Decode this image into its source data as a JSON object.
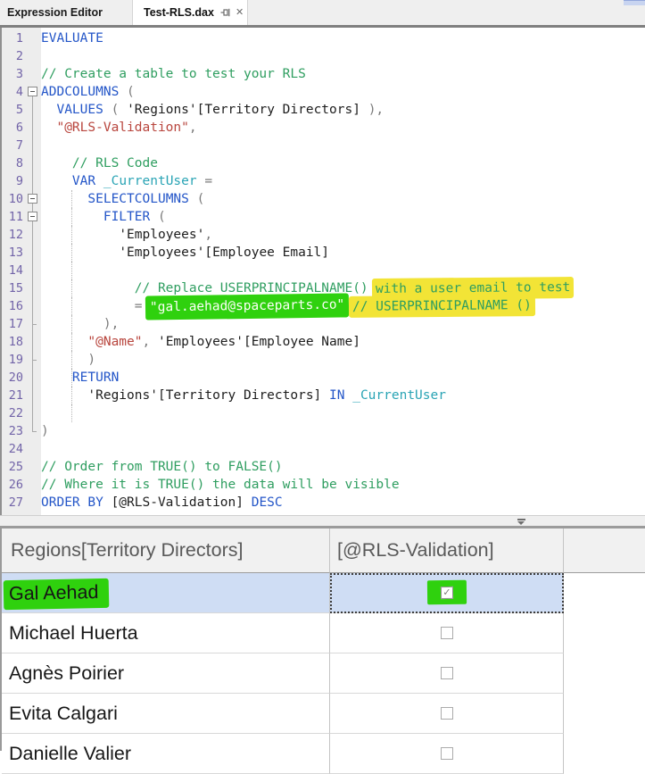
{
  "tabs": {
    "pane_title": "Expression Editor",
    "active_tab": "Test-RLS.dax",
    "pin_icon": "pin",
    "close_glyph": "✕"
  },
  "editor": {
    "lines": [
      {
        "f": "",
        "s": [
          {
            "t": "EVALUATE",
            "c": "k"
          }
        ]
      },
      {
        "f": "",
        "s": []
      },
      {
        "f": "",
        "s": [
          {
            "t": "// Create a table to test your RLS",
            "c": "c"
          }
        ]
      },
      {
        "f": "b0",
        "s": [
          {
            "t": "ADDCOLUMNS ",
            "c": "k"
          },
          {
            "t": "(",
            "c": "p"
          }
        ]
      },
      {
        "f": "l",
        "s": [
          {
            "t": "  ",
            "c": "t"
          },
          {
            "t": "VALUES",
            "c": "k"
          },
          {
            "t": " ( ",
            "c": "p"
          },
          {
            "t": "'Regions'[Territory Directors]",
            "c": "t"
          },
          {
            "t": " ),",
            "c": "p"
          }
        ]
      },
      {
        "f": "l",
        "s": [
          {
            "t": "  ",
            "c": "t"
          },
          {
            "t": "\"@RLS-Validation\"",
            "c": "s"
          },
          {
            "t": ",",
            "c": "p"
          }
        ]
      },
      {
        "f": "l",
        "s": []
      },
      {
        "f": "l",
        "s": [
          {
            "t": "    ",
            "c": "t"
          },
          {
            "t": "// RLS Code",
            "c": "c"
          }
        ]
      },
      {
        "f": "l",
        "s": [
          {
            "t": "    ",
            "c": "t"
          },
          {
            "t": "VAR",
            "c": "k"
          },
          {
            "t": " ",
            "c": "t"
          },
          {
            "t": "_CurrentUser",
            "c": "v"
          },
          {
            "t": " =",
            "c": "p"
          }
        ]
      },
      {
        "f": "b",
        "s": [
          {
            "t": "      ",
            "c": "t"
          },
          {
            "t": "SELECTCOLUMNS",
            "c": "k"
          },
          {
            "t": " (",
            "c": "p"
          }
        ]
      },
      {
        "f": "b",
        "s": [
          {
            "t": "        ",
            "c": "t"
          },
          {
            "t": "FILTER",
            "c": "k"
          },
          {
            "t": " (",
            "c": "p"
          }
        ]
      },
      {
        "f": "l",
        "s": [
          {
            "t": "          ",
            "c": "t"
          },
          {
            "t": "'Employees'",
            "c": "t"
          },
          {
            "t": ",",
            "c": "p"
          }
        ]
      },
      {
        "f": "l",
        "s": [
          {
            "t": "          ",
            "c": "t"
          },
          {
            "t": "'Employees'[Employee Email]",
            "c": "t"
          }
        ]
      },
      {
        "f": "l",
        "s": []
      },
      {
        "f": "l",
        "s": [
          {
            "t": "            ",
            "c": "t"
          },
          {
            "t": "// Replace USERPRINCIPALNAME() ",
            "c": "c"
          },
          {
            "t": "with a user email to test",
            "c": "c",
            "hl": "y"
          }
        ]
      },
      {
        "f": "l",
        "s": [
          {
            "t": "            ",
            "c": "t"
          },
          {
            "t": "= ",
            "c": "p"
          },
          {
            "t": "\"gal.aehad@spaceparts.co\"",
            "c": "s",
            "hl": "g"
          },
          {
            "t": " ",
            "c": "t"
          },
          {
            "t": "// USERPRINCIPALNAME ()",
            "c": "c",
            "hl": "y"
          }
        ]
      },
      {
        "f": "cm",
        "s": [
          {
            "t": "        ",
            "c": "t"
          },
          {
            "t": "),",
            "c": "p"
          }
        ]
      },
      {
        "f": "l",
        "s": [
          {
            "t": "      ",
            "c": "t"
          },
          {
            "t": "\"@Name\"",
            "c": "s"
          },
          {
            "t": ", ",
            "c": "p"
          },
          {
            "t": "'Employees'[Employee Name]",
            "c": "t"
          }
        ]
      },
      {
        "f": "cm",
        "s": [
          {
            "t": "      ",
            "c": "t"
          },
          {
            "t": ")",
            "c": "p"
          }
        ]
      },
      {
        "f": "l",
        "s": [
          {
            "t": "    ",
            "c": "t"
          },
          {
            "t": "RETURN",
            "c": "k"
          }
        ]
      },
      {
        "f": "l",
        "s": [
          {
            "t": "      ",
            "c": "t"
          },
          {
            "t": "'Regions'[Territory Directors] ",
            "c": "t"
          },
          {
            "t": "IN",
            "c": "k"
          },
          {
            "t": " ",
            "c": "t"
          },
          {
            "t": "_CurrentUser",
            "c": "v"
          }
        ]
      },
      {
        "f": "l",
        "s": []
      },
      {
        "f": "ce",
        "s": [
          {
            "t": ")",
            "c": "p"
          }
        ]
      },
      {
        "f": "",
        "s": []
      },
      {
        "f": "",
        "s": [
          {
            "t": "// Order from TRUE() to FALSE()",
            "c": "c"
          }
        ]
      },
      {
        "f": "",
        "s": [
          {
            "t": "// Where it is TRUE() the data will be visible",
            "c": "c"
          }
        ]
      },
      {
        "f": "",
        "s": [
          {
            "t": "ORDER BY ",
            "c": "k"
          },
          {
            "t": "[@RLS-Validation]",
            "c": "t"
          },
          {
            "t": " ",
            "c": "t"
          },
          {
            "t": "DESC",
            "c": "k"
          }
        ]
      }
    ]
  },
  "results": {
    "columns": [
      "Regions[Territory Directors]",
      "[@RLS-Validation]"
    ],
    "checkmark": "✓",
    "rows": [
      {
        "name": "Gal Aehad",
        "validated": true,
        "selected": true,
        "name_highlight": true,
        "checkbox_highlight": true
      },
      {
        "name": "Michael Huerta",
        "validated": false
      },
      {
        "name": "Agnès Poirier",
        "validated": false
      },
      {
        "name": "Evita Calgari",
        "validated": false
      },
      {
        "name": "Danielle Valier",
        "validated": false
      }
    ]
  },
  "colors": {
    "keyword": "#2456c8",
    "comment": "#2f9e60",
    "string": "#b8453d",
    "punctuation": "#7b7b7b",
    "plain": "#1d1d1d",
    "variable": "#2aa4b5",
    "line_number": "#7264a8",
    "marker_green": "#2fd10e",
    "marker_yellow": "#f2e436",
    "selected_row": "#cfddf4"
  }
}
